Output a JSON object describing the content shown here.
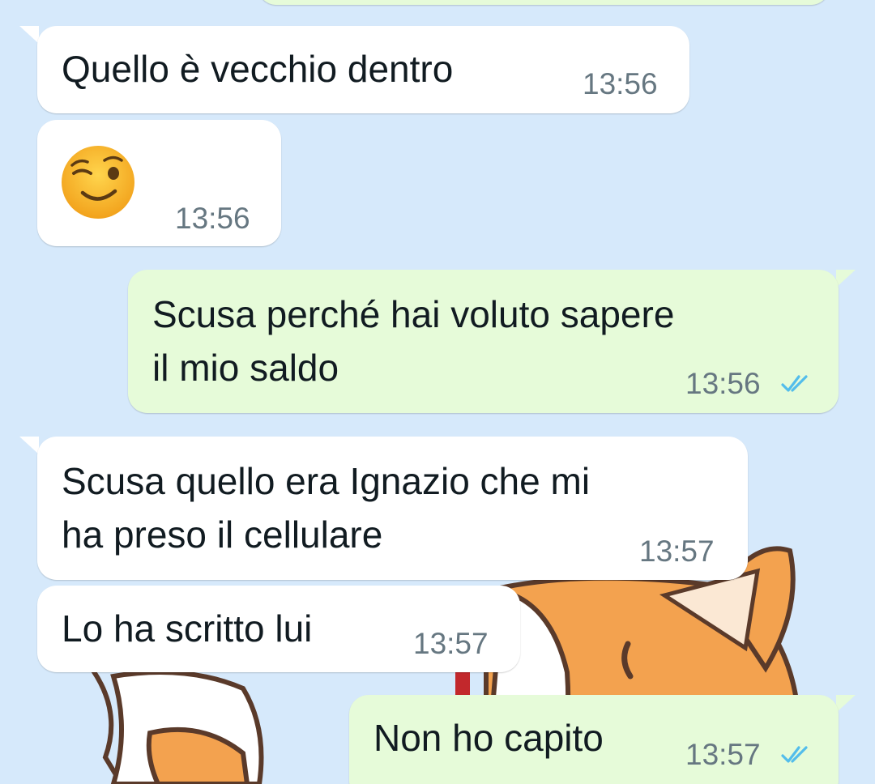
{
  "colors": {
    "chat_background": "#d6e9fb",
    "incoming_bubble": "#ffffff",
    "outgoing_bubble": "#e6fbd9",
    "message_text": "#111b21",
    "timestamp_text": "#667781",
    "read_ticks": "#53bdeb"
  },
  "messages": [
    {
      "direction": "incoming",
      "text": "Quello è vecchio dentro",
      "time": "13:56"
    },
    {
      "direction": "incoming",
      "emoji": "winking-face",
      "time": "13:56"
    },
    {
      "direction": "outgoing",
      "text": "Scusa perché hai voluto sapere\nil mio saldo",
      "time": "13:56",
      "status": "read"
    },
    {
      "direction": "incoming",
      "text": "Scusa quello era Ignazio che mi\nha preso il cellulare",
      "time": "13:57"
    },
    {
      "direction": "incoming",
      "text": "Lo ha scritto lui",
      "time": "13:57"
    },
    {
      "direction": "outgoing",
      "text": "Non ho capito",
      "time": "13:57",
      "status": "read"
    }
  ]
}
